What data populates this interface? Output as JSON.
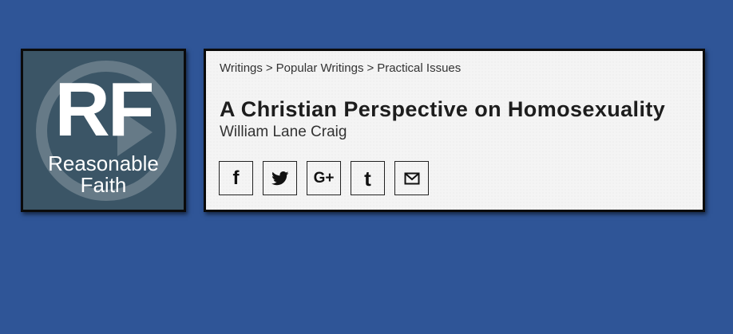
{
  "logo": {
    "mark": "RF",
    "line1": "Reasonable",
    "line2": "Faith",
    "bg_color": "#3b5566"
  },
  "breadcrumb": {
    "items": [
      "Writings",
      "Popular Writings",
      "Practical Issues"
    ],
    "separator": ">"
  },
  "article": {
    "title": "A Christian Perspective on Homosexuality",
    "author": "William Lane Craig"
  },
  "share": {
    "buttons": [
      {
        "icon": "facebook-icon",
        "glyph": "f"
      },
      {
        "icon": "twitter-icon",
        "glyph": ""
      },
      {
        "icon": "google-plus-icon",
        "glyph": "G+"
      },
      {
        "icon": "tumblr-icon",
        "glyph": "t"
      },
      {
        "icon": "email-icon",
        "glyph": ""
      }
    ]
  },
  "colors": {
    "page_bg": "#2f5597",
    "card_bg": "#f4f4f4",
    "border": "#0b0b0b"
  }
}
